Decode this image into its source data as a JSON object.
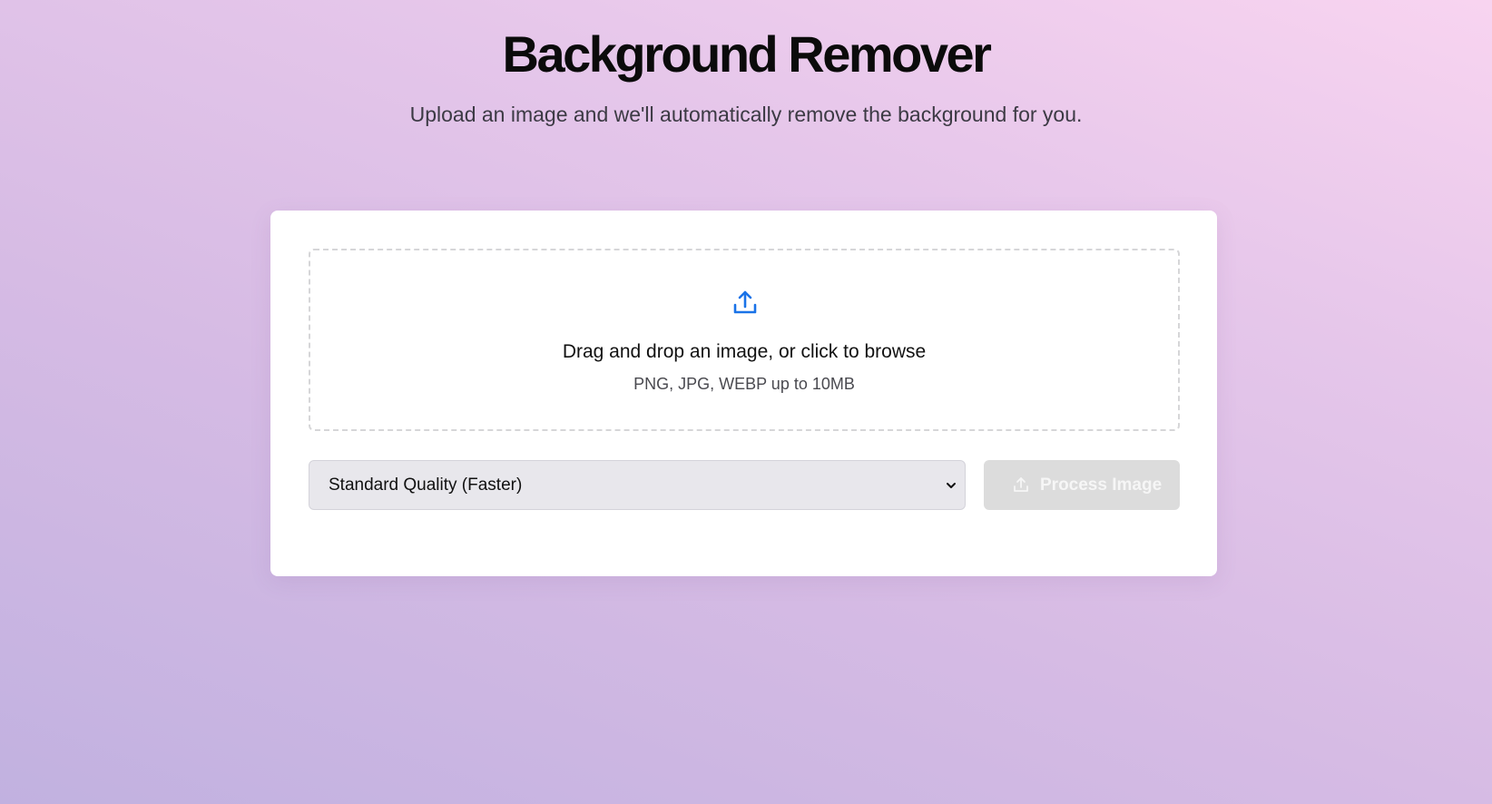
{
  "header": {
    "title": "Background Remover",
    "subtitle": "Upload an image and we'll automatically remove the background for you."
  },
  "upload": {
    "icon": "upload-icon",
    "primary_text": "Drag and drop an image, or click to browse",
    "hint_text": "PNG, JPG, WEBP up to 10MB"
  },
  "quality_select": {
    "selected": "Standard Quality (Faster)",
    "icon": "chevron-down-icon"
  },
  "process_button": {
    "label": "Process Image",
    "icon": "upload-icon",
    "disabled": true
  },
  "colors": {
    "accent": "#1a73e8",
    "button_disabled_bg": "#dcdcdc",
    "select_bg": "#e8e7ec"
  }
}
